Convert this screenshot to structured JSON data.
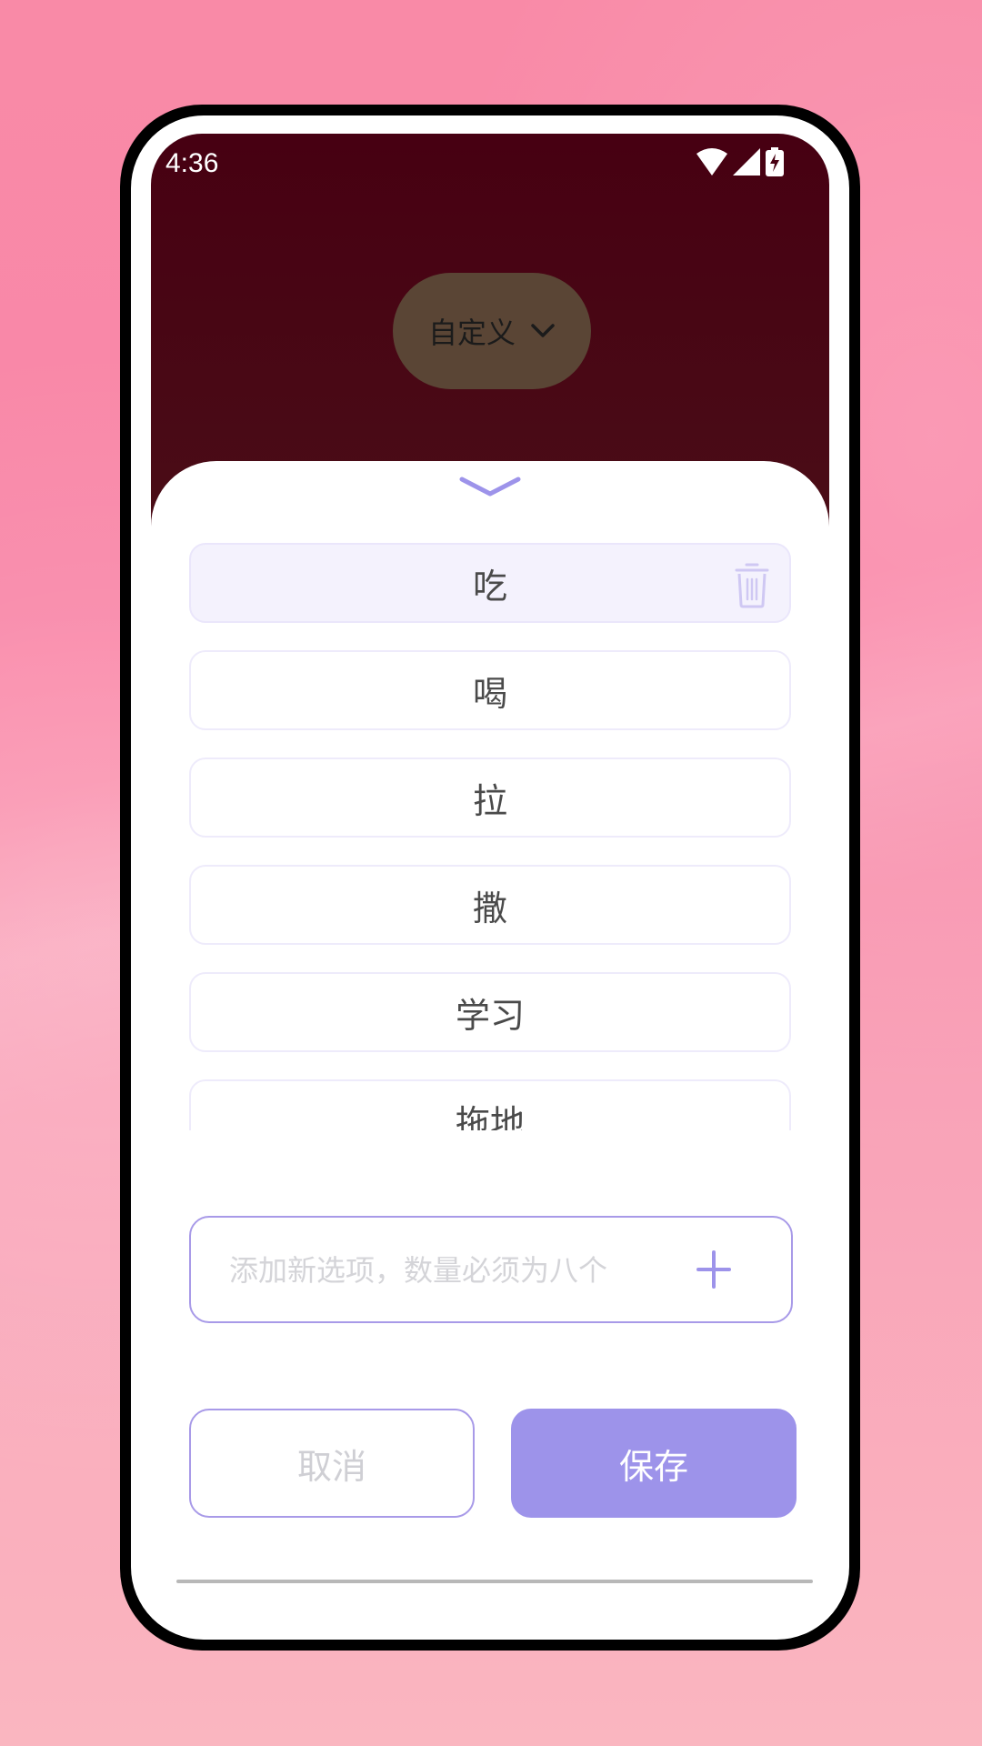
{
  "status_bar": {
    "time": "4:36",
    "icons": [
      "wifi-icon",
      "signal-icon",
      "battery-charging-icon"
    ]
  },
  "mode_selector": {
    "label": "自定义",
    "icon": "chevron-down-icon"
  },
  "sheet": {
    "collapse_icon": "chevron-down-icon",
    "options": [
      {
        "label": "吃",
        "selected": true,
        "action_icon": "trash-icon"
      },
      {
        "label": "喝",
        "selected": false
      },
      {
        "label": "拉",
        "selected": false
      },
      {
        "label": "撒",
        "selected": false
      },
      {
        "label": "学习",
        "selected": false
      },
      {
        "label": "拖地",
        "selected": false
      }
    ],
    "add_field": {
      "value": "",
      "placeholder": "添加新选项，数量必须为八个",
      "add_icon": "plus-icon"
    },
    "cancel_label": "取消",
    "save_label": "保存"
  },
  "colors": {
    "accent": "#9d93ea",
    "accent_border": "#a89ae8",
    "header_bg": "#470012",
    "selected_row_bg": "#f4f2fd"
  }
}
